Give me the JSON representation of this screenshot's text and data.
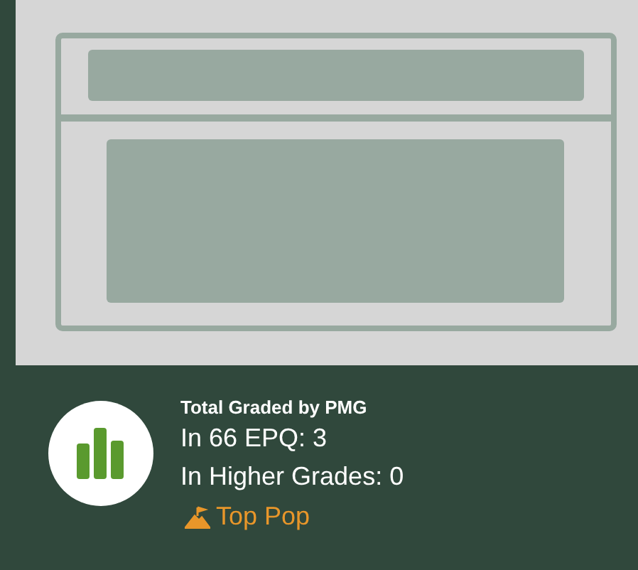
{
  "population": {
    "title": "Total Graded by PMG",
    "lines": [
      "In 66 EPQ: 3",
      "In Higher Grades: 0"
    ],
    "link": "Top Pop"
  }
}
